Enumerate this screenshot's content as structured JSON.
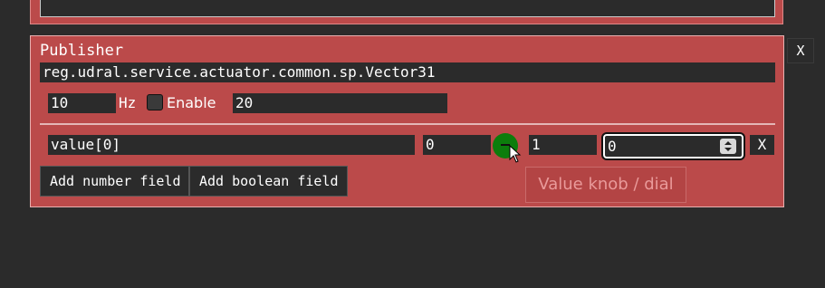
{
  "previous_panel": {
    "text": ""
  },
  "outer_close_label": "X",
  "publisher": {
    "title": "Publisher",
    "subject": "reg.udral.service.actuator.common.sp.Vector31",
    "rate_value": "10",
    "rate_unit": "Hz",
    "enable_label": "Enable",
    "enable_checked": false,
    "port_value": "20"
  },
  "field_row": {
    "name": "value[0]",
    "min": "0",
    "max": "1",
    "value": "0",
    "remove_label": "X"
  },
  "buttons": {
    "add_number": "Add number field",
    "add_boolean": "Add boolean field"
  },
  "tooltip": "Value knob / dial",
  "colors": {
    "panel": "#bb4a4a",
    "background": "#2b2b2b",
    "knob": "#0c7d0c"
  }
}
